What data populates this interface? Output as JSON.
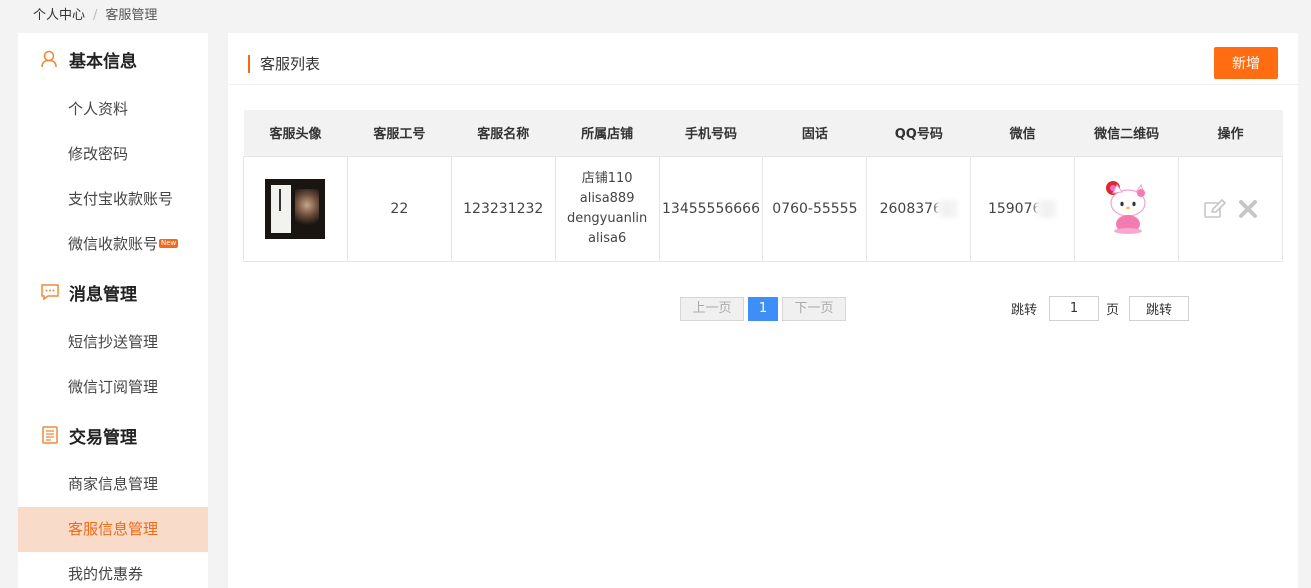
{
  "breadcrumb": {
    "home": "个人中心",
    "separator": "/",
    "current": "客服管理"
  },
  "sidebar": {
    "sections": [
      {
        "title": "基本信息",
        "icon": "user-icon",
        "items": [
          "个人资料",
          "修改密码",
          "支付宝收款账号",
          "微信收款账号"
        ]
      },
      {
        "title": "消息管理",
        "icon": "message-icon",
        "items": [
          "短信抄送管理",
          "微信订阅管理"
        ]
      },
      {
        "title": "交易管理",
        "icon": "document-icon",
        "items": [
          "商家信息管理",
          "客服信息管理",
          "我的优惠券"
        ]
      }
    ],
    "new_badge": "New",
    "active_item": "客服信息管理"
  },
  "panel": {
    "title": "客服列表",
    "add_button": "新增"
  },
  "table": {
    "headers": [
      "客服头像",
      "客服工号",
      "客服名称",
      "所属店铺",
      "手机号码",
      "固话",
      "QQ号码",
      "微信",
      "微信二维码",
      "操作"
    ],
    "rows": [
      {
        "id": "22",
        "name": "123231232",
        "stores": [
          "店铺110",
          "alisa889",
          "dengyuanlin",
          "alisa6"
        ],
        "phone": "13455556666",
        "tel": "0760-55555",
        "qq": "2608376",
        "wechat": "159076"
      }
    ]
  },
  "pagination": {
    "prev": "上一页",
    "current": "1",
    "next": "下一页"
  },
  "jump": {
    "label": "跳转",
    "page_value": "1",
    "page_unit": "页",
    "button": "跳转"
  },
  "colors": {
    "accent": "#ff6c12",
    "active_bg": "#f8dcc9",
    "page_blue": "#3e8ef7"
  }
}
